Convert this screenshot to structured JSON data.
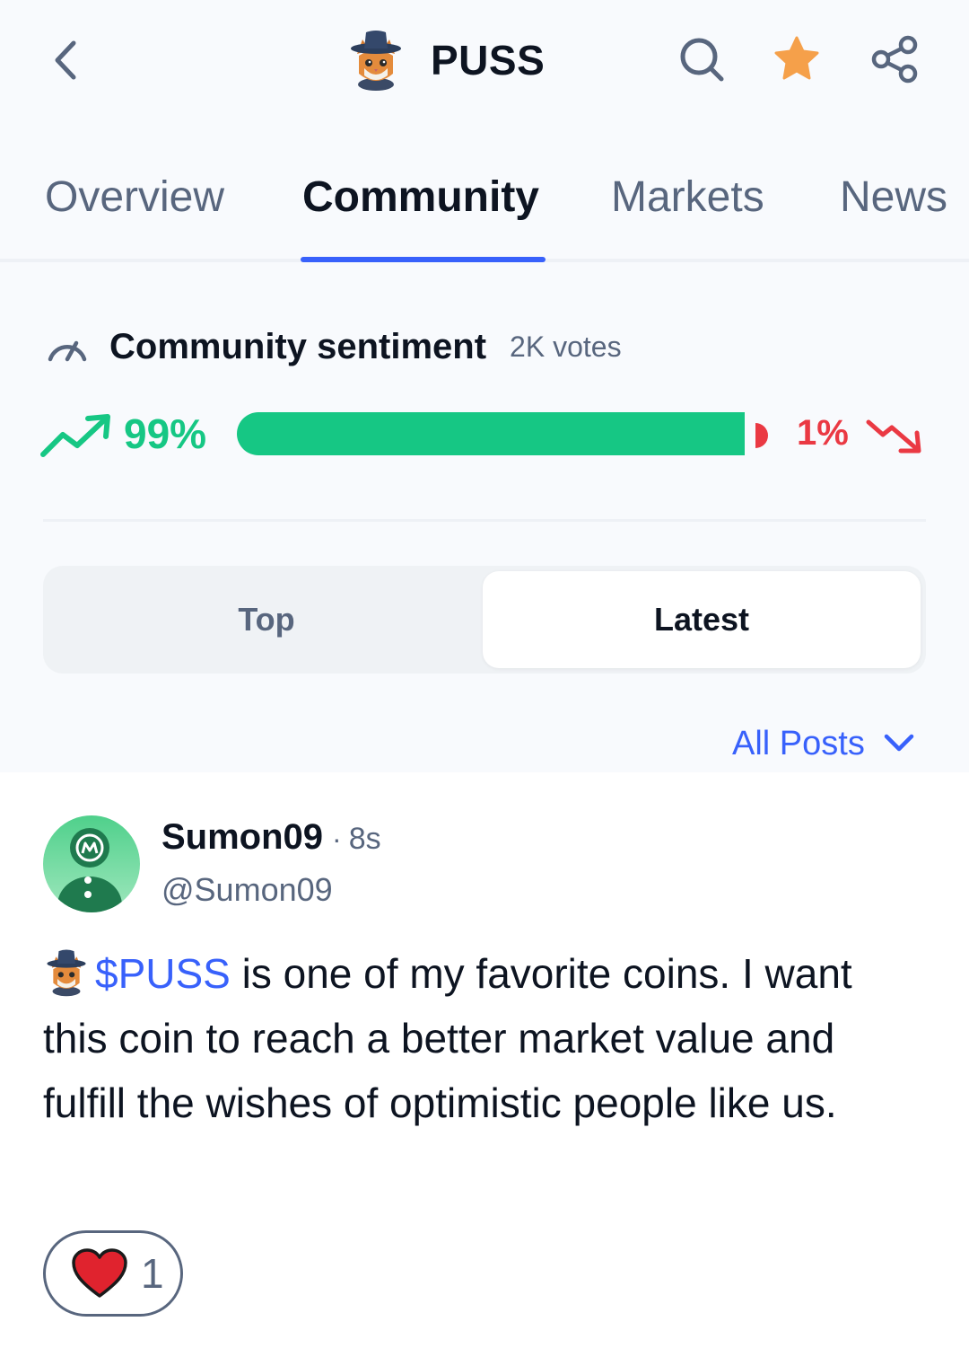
{
  "header": {
    "title": "PUSS",
    "back_icon": "chevron-left-icon",
    "search_icon": "search-icon",
    "star_icon": "star-icon",
    "share_icon": "share-icon",
    "star_color": "#f5a04a"
  },
  "tabs": [
    {
      "label": "Overview",
      "active": false
    },
    {
      "label": "Community",
      "active": true
    },
    {
      "label": "Markets",
      "active": false
    },
    {
      "label": "News",
      "active": false
    }
  ],
  "sentiment": {
    "title": "Community sentiment",
    "votes": "2K votes",
    "bullish_label": "99%",
    "bearish_label": "1%",
    "bullish_fraction": 0.99,
    "bearish_fraction": 0.01,
    "bullish_color": "#16c784",
    "bearish_color": "#ea3943"
  },
  "feed_toggle": {
    "options": [
      "Top",
      "Latest"
    ],
    "selected": "Latest"
  },
  "filter": {
    "label": "All Posts"
  },
  "post": {
    "author": "Sumon09",
    "separator": "·",
    "time": "8s",
    "handle": "@Sumon09",
    "cashtag": "$PUSS",
    "text": " is one of my favorite coins. I want this coin to reach a better market value and fulfill the wishes of optimistic people like us.",
    "reaction_count": "1"
  }
}
